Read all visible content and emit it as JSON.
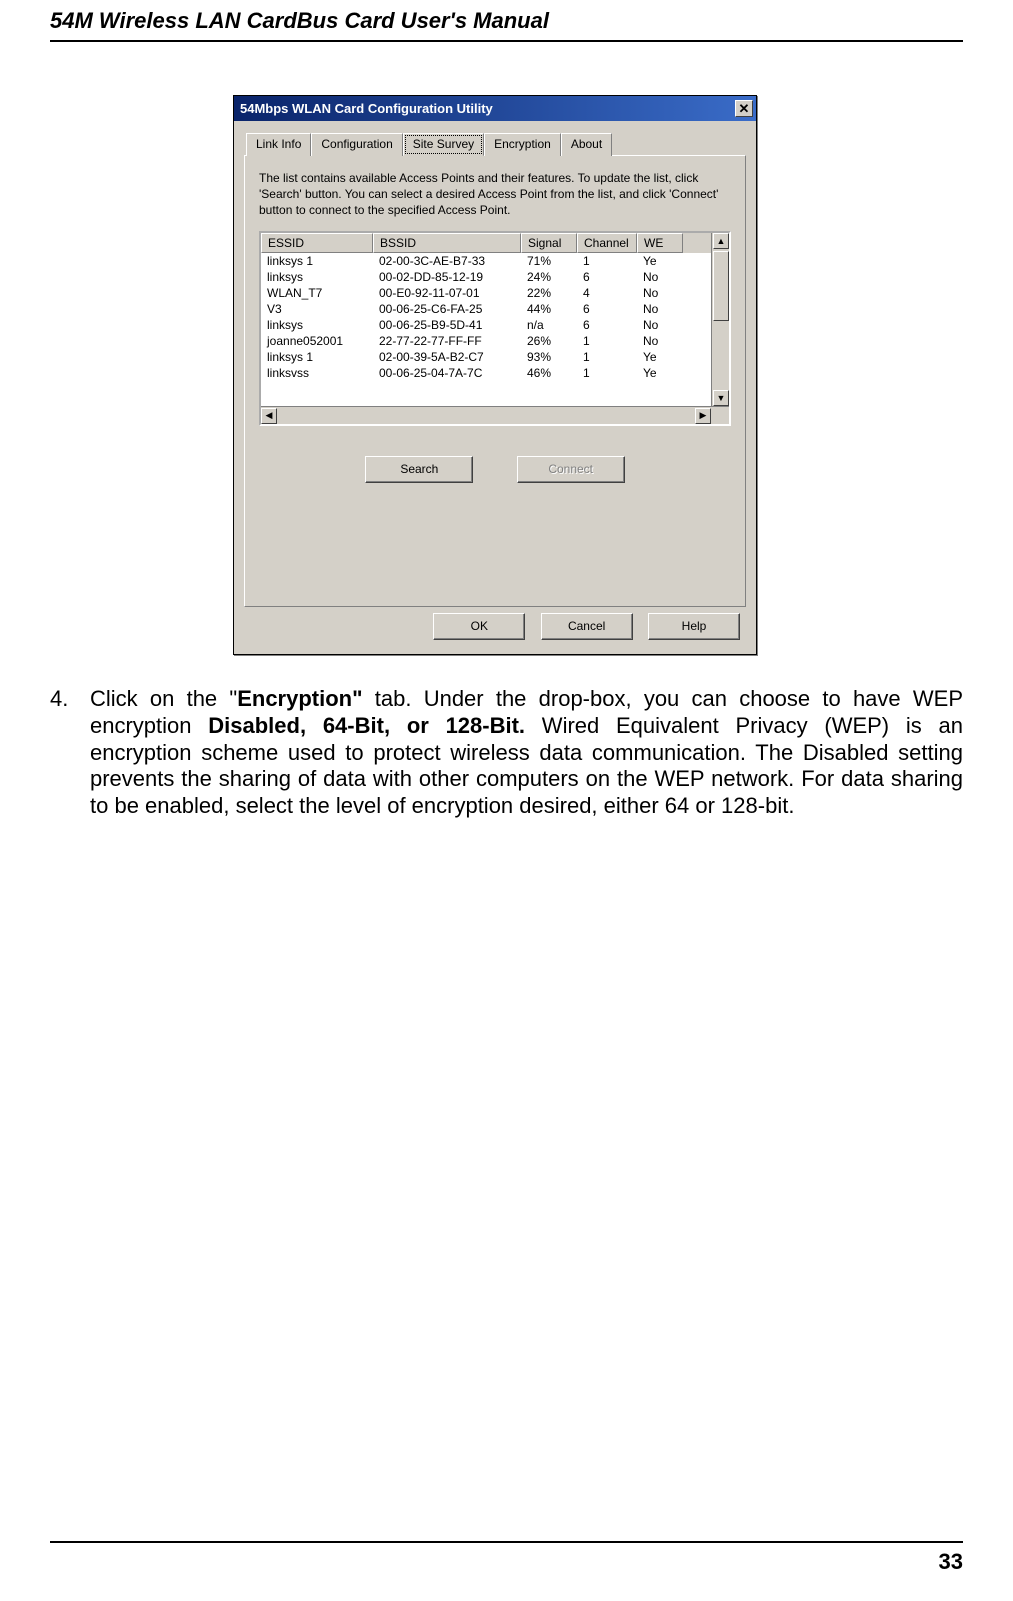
{
  "header": {
    "title": "54M Wireless LAN CardBus Card User's Manual"
  },
  "footer": {
    "page_number": "33"
  },
  "screenshot": {
    "window_title": "54Mbps WLAN Card Configuration Utility",
    "close_glyph": "✕",
    "tabs": [
      {
        "label": "Link Info"
      },
      {
        "label": "Configuration"
      },
      {
        "label": "Site Survey"
      },
      {
        "label": "Encryption"
      },
      {
        "label": "About"
      }
    ],
    "active_tab_index": 2,
    "description": "The list contains available Access Points and their features. To update the list, click 'Search' button. You can select a desired Access Point from the list, and click 'Connect' button to connect to the specified Access Point.",
    "columns": {
      "essid": "ESSID",
      "bssid": "BSSID",
      "signal": "Signal",
      "channel": "Channel",
      "wep": "WE"
    },
    "rows": [
      {
        "essid": "linksys 1",
        "bssid": "02-00-3C-AE-B7-33",
        "signal": "71%",
        "channel": "1",
        "wep": "Ye"
      },
      {
        "essid": "linksys",
        "bssid": "00-02-DD-85-12-19",
        "signal": "24%",
        "channel": "6",
        "wep": "No"
      },
      {
        "essid": "WLAN_T7",
        "bssid": "00-E0-92-11-07-01",
        "signal": "22%",
        "channel": "4",
        "wep": "No"
      },
      {
        "essid": "V3",
        "bssid": "00-06-25-C6-FA-25",
        "signal": "44%",
        "channel": "6",
        "wep": "No"
      },
      {
        "essid": "linksys",
        "bssid": "00-06-25-B9-5D-41",
        "signal": "n/a",
        "channel": "6",
        "wep": "No"
      },
      {
        "essid": "joanne052001",
        "bssid": "22-77-22-77-FF-FF",
        "signal": "26%",
        "channel": "1",
        "wep": "No"
      },
      {
        "essid": "linksys 1",
        "bssid": "02-00-39-5A-B2-C7",
        "signal": "93%",
        "channel": "1",
        "wep": "Ye"
      },
      {
        "essid": "linksvss",
        "bssid": "00-06-25-04-7A-7C",
        "signal": "46%",
        "channel": "1",
        "wep": "Ye"
      }
    ],
    "buttons": {
      "search": "Search",
      "connect": "Connect",
      "ok": "OK",
      "cancel": "Cancel",
      "help": "Help"
    },
    "scroll_glyphs": {
      "up": "▲",
      "down": "▼",
      "left": "◀",
      "right": "▶"
    }
  },
  "body": {
    "number": "4.",
    "t1": "Click on the \"",
    "t2": "Encryption\"",
    "t3": " tab. Under the drop-box, you can choose to have WEP encryption ",
    "t4": "Disabled, 64-Bit, or 128-Bit.",
    "t5": " Wired Equivalent Privacy (WEP) is an encryption scheme used to protect wireless data communication. The Disabled setting prevents the sharing of data with other computers on the WEP network. For data sharing to be enabled, select the level of encryption desired, either 64 or 128-bit."
  }
}
